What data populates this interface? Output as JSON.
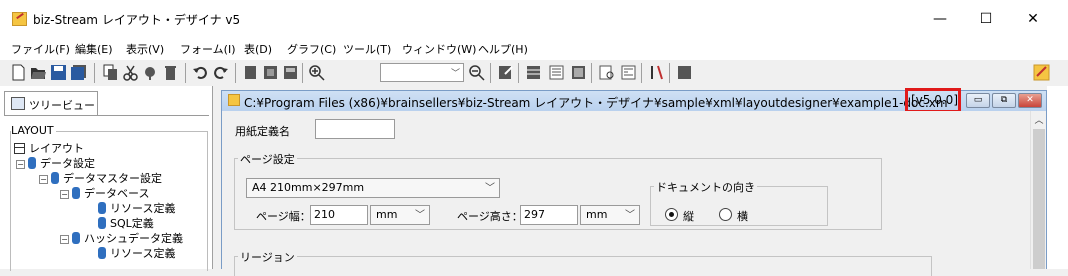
{
  "window": {
    "title": "biz-Stream レイアウト・デザイナ v5",
    "minimize": "—",
    "maximize": "☐",
    "close": "✕"
  },
  "menu": [
    "ファイル(F)",
    "編集(E)",
    "表示(V)",
    "フォーム(I)",
    "表(D)",
    "グラフ(C)",
    "ツール(T)",
    "ウィンドウ(W)",
    "ヘルプ(H)"
  ],
  "toolbar": {
    "zoom_value": ""
  },
  "tree": {
    "tab_label": "ツリービュー",
    "group_label": "LAYOUT",
    "nodes": [
      {
        "label": "レイアウト",
        "type": "layout"
      },
      {
        "label": "データ設定",
        "type": "db"
      },
      {
        "label": "データマスター設定",
        "type": "db"
      },
      {
        "label": "データベース",
        "type": "db"
      },
      {
        "label": "リソース定義",
        "type": "db"
      },
      {
        "label": "SQL定義",
        "type": "db"
      },
      {
        "label": "ハッシュデータ定義",
        "type": "db"
      },
      {
        "label": "リソース定義",
        "type": "db"
      }
    ]
  },
  "document": {
    "path": "C:¥Program Files (x86)¥brainsellers¥biz-Stream レイアウト・デザイナ¥sample¥xml¥layoutdesigner¥example1-doc.xm",
    "version": "[v5.0.0]",
    "paper_name_label": "用紙定義名",
    "paper_name_value": "",
    "page_settings": {
      "title": "ページ設定",
      "size_selected": "A4 210mm×297mm",
      "width_label": "ページ幅：",
      "width_value": "210",
      "width_unit": "mm",
      "height_label": "ページ高さ：",
      "height_value": "297",
      "height_unit": "mm",
      "orientation": {
        "title": "ドキュメントの向き",
        "portrait": "縦",
        "landscape": "横",
        "selected": "portrait"
      }
    },
    "region_label": "リージョン"
  },
  "colors": {
    "highlight": "#e01a1a",
    "doc_titlebar": "#c3d8f1"
  }
}
